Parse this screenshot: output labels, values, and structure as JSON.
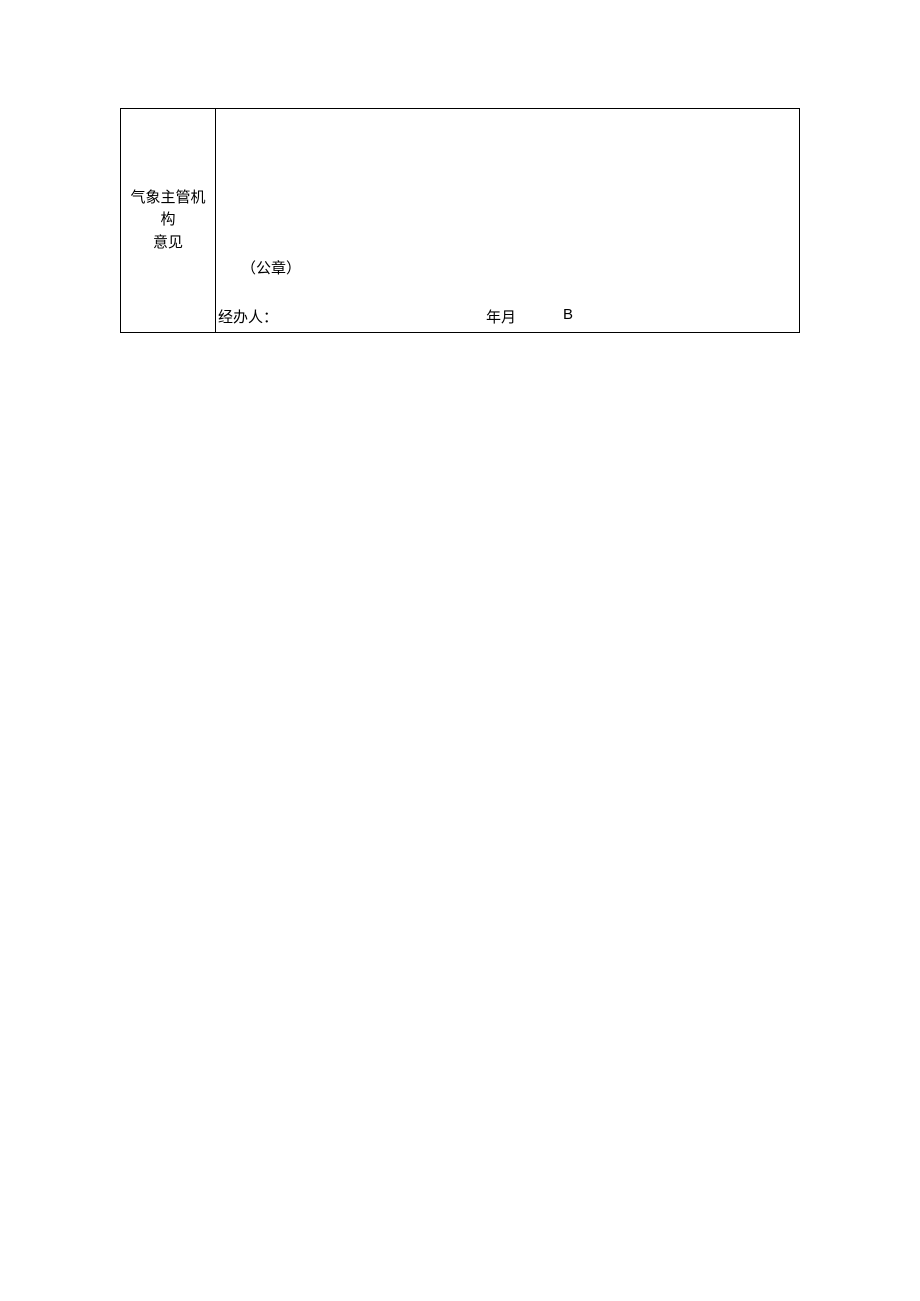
{
  "form": {
    "row_label_line1": "气象主管机构",
    "row_label_line2": "意见",
    "seal_label": "（公章）",
    "handler_label": "经办人：",
    "date_label": "年月",
    "end_marker": "B"
  }
}
